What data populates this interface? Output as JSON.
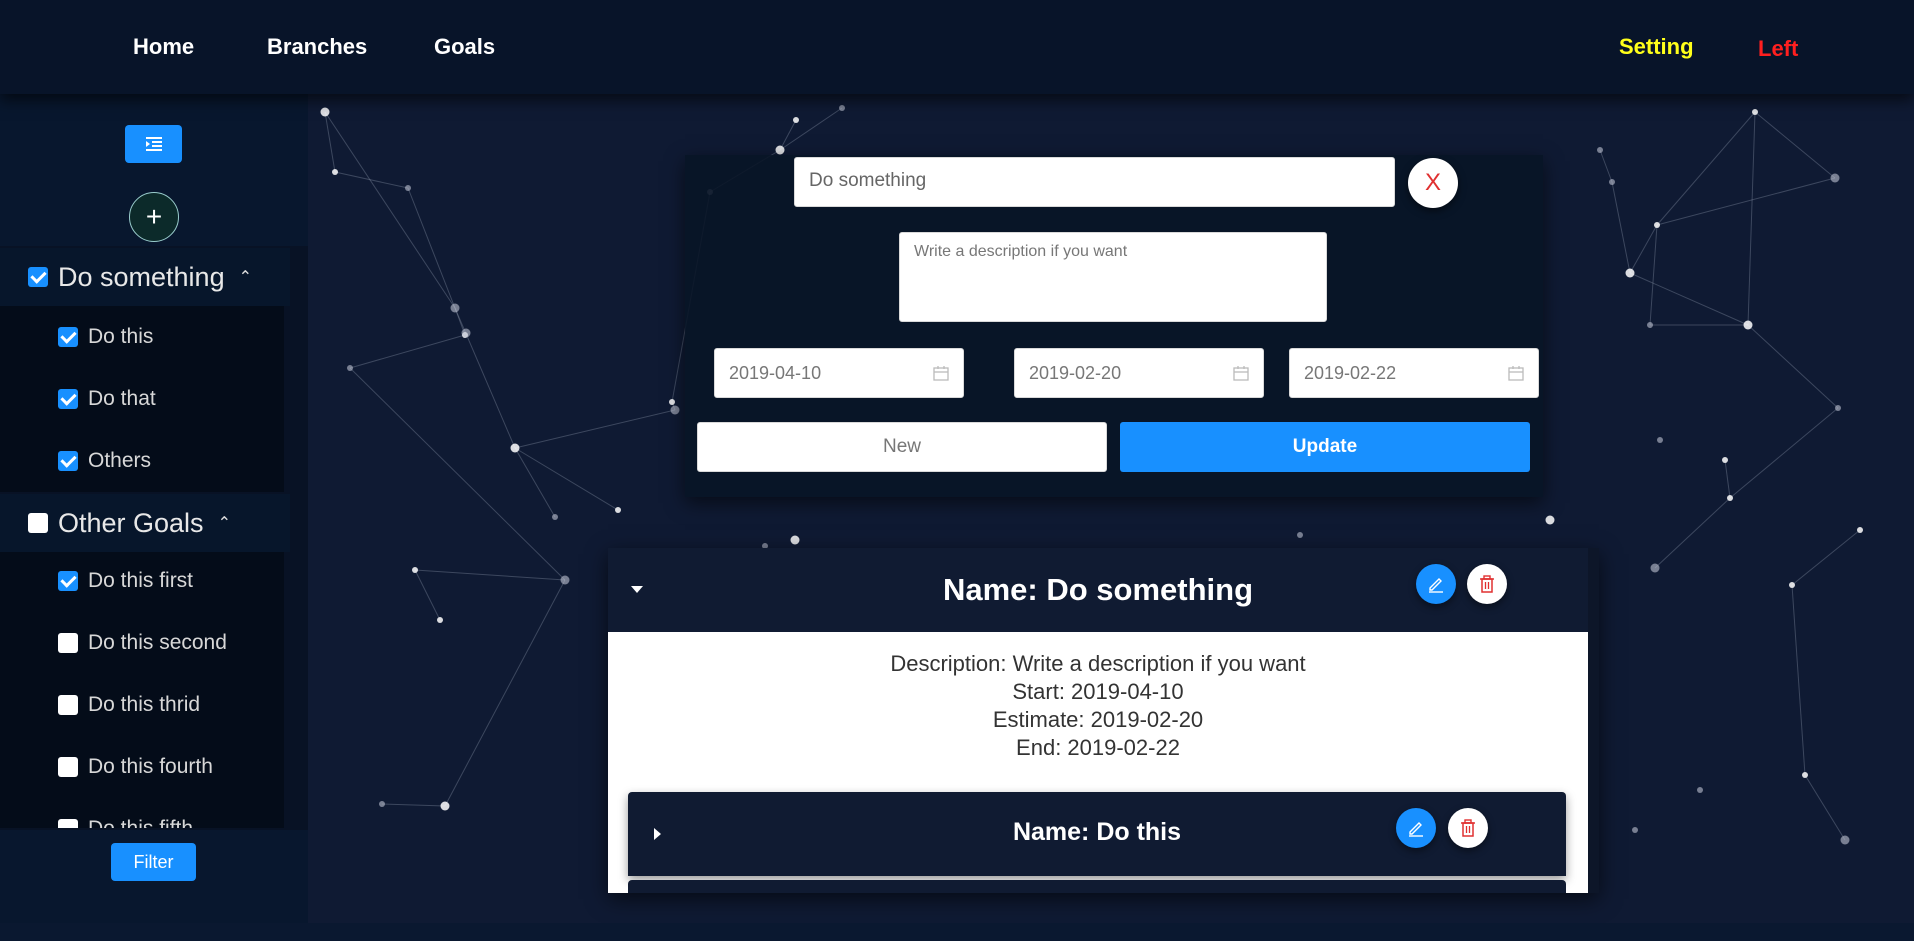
{
  "nav": {
    "home": "Home",
    "branches": "Branches",
    "goals": "Goals",
    "setting": "Setting",
    "left": "Left",
    "colors": {
      "setting": "#ffff1a",
      "left": "#ff1f1f"
    }
  },
  "sidebar": {
    "collapse_icon": "menu-fold-icon",
    "add_icon": "plus-icon",
    "groups": [
      {
        "label": "Do something",
        "checked": true,
        "items": [
          {
            "label": "Do this",
            "checked": true
          },
          {
            "label": "Do that",
            "checked": true
          },
          {
            "label": "Others",
            "checked": true
          }
        ]
      },
      {
        "label": "Other Goals",
        "checked": false,
        "items": [
          {
            "label": "Do this first",
            "checked": true
          },
          {
            "label": "Do this second",
            "checked": false
          },
          {
            "label": "Do this thrid",
            "checked": false
          },
          {
            "label": "Do this fourth",
            "checked": false
          },
          {
            "label": "Do this fifth",
            "checked": false
          }
        ]
      }
    ],
    "filter_label": "Filter"
  },
  "form": {
    "name_value": "Do something",
    "close_label": "X",
    "description_placeholder": "Write a description if you want",
    "start_date": "2019-04-10",
    "estimate_date": "2019-02-20",
    "end_date": "2019-02-22",
    "new_label": "New",
    "update_label": "Update"
  },
  "detail": {
    "title": "Name: Do something",
    "description": "Description: Write a description if you want",
    "start": "Start: 2019-04-10",
    "estimate": "Estimate: 2019-02-20",
    "end": "End: 2019-02-22",
    "children": [
      {
        "title": "Name: Do this"
      }
    ]
  },
  "colors": {
    "accent": "#1890ff",
    "background": "#0f1a33",
    "danger": "#e03030"
  }
}
